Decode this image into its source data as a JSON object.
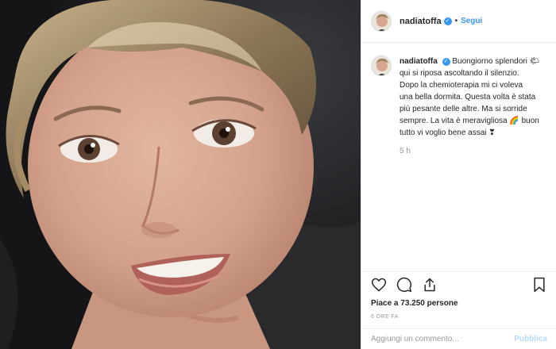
{
  "post": {
    "photo_alt": "",
    "author": {
      "username": "nadiatoffa",
      "verified_icon": "verified-badge-icon",
      "separator": "•",
      "follow_label": "Segui"
    },
    "caption": {
      "username": "nadiatoffa",
      "lines": [
        "Buongiorno splendori 🌤",
        "qui si riposa ascoltando il silenzio.",
        "Dopo la chemioterapia mi ci voleva",
        "una bella dormita. Questa volta è stata",
        "più pesante delle altre. Ma si sorride",
        "sempre. La vita è meravigliosa 🌈 buon",
        "tutto vi voglio bene assai ❣"
      ],
      "time": "5 h"
    },
    "actions": {
      "like_icon": "heart-icon",
      "comment_icon": "comment-icon",
      "share_icon": "share-icon",
      "save_icon": "bookmark-icon"
    },
    "likes": "Piace a 73.250 persone",
    "posted_ago": "6 ORE FA",
    "comment_box": {
      "placeholder": "Aggiungi un commento...",
      "publish_label": "Pubblica"
    }
  },
  "colors": {
    "accent": "#3897f0",
    "publish_disabled": "#b3dbff",
    "muted_text": "#999999"
  }
}
